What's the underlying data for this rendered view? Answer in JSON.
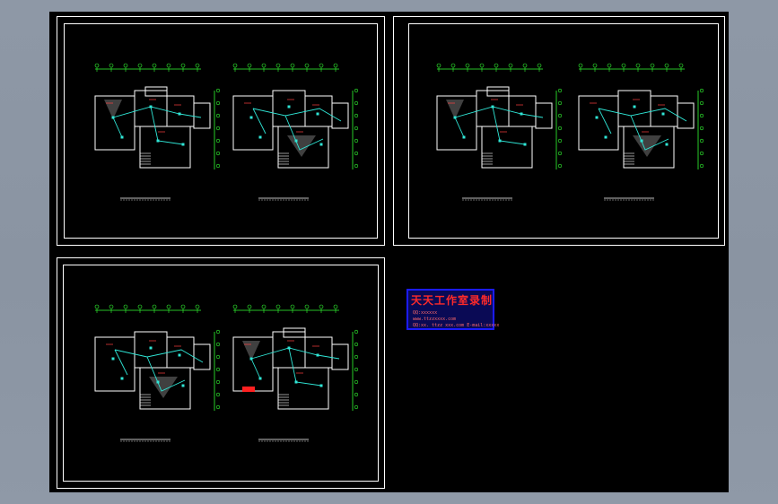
{
  "viewport": {
    "background": "#8e98a6",
    "canvas_color": "#000000"
  },
  "drawing_colors": {
    "frame": "#ffffff",
    "walls": "#ffffff",
    "wiring": "#2fe6d6",
    "dimensions": "#33ff33",
    "axis_markers": "#33ff33",
    "labels": "#ff4040",
    "hatch": "#ffffff"
  },
  "sheets": [
    {
      "id": "sheet-1",
      "plans": [
        "plan-a",
        "plan-b"
      ]
    },
    {
      "id": "sheet-2",
      "plans": [
        "plan-a",
        "plan-b"
      ]
    },
    {
      "id": "sheet-3",
      "plans": [
        "plan-a",
        "plan-b"
      ]
    }
  ],
  "watermark": {
    "title": "天天工作室录制",
    "line1": "QQ:xxxxxx",
    "line2": "www.ttzzxxxx.com",
    "line3": "QQ:xx. ttzz xxx.com E-mail:xxxxx",
    "border_color": "#1b1bff",
    "text_color": "#ff2a2a"
  }
}
